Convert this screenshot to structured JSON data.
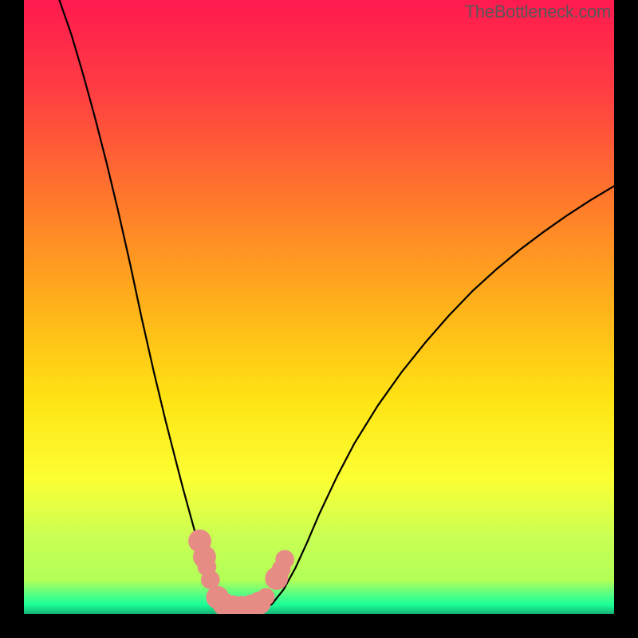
{
  "watermark": "TheBottleneck.com",
  "chart_data": {
    "type": "line",
    "title": "",
    "xlabel": "",
    "ylabel": "",
    "xlim": [
      0,
      100
    ],
    "ylim": [
      0,
      100
    ],
    "grid": false,
    "gradient_stops": [
      {
        "offset": 0.0,
        "color": "#ff1a4f"
      },
      {
        "offset": 0.15,
        "color": "#ff3e42"
      },
      {
        "offset": 0.33,
        "color": "#ff7a2b"
      },
      {
        "offset": 0.5,
        "color": "#ffb21a"
      },
      {
        "offset": 0.65,
        "color": "#ffe314"
      },
      {
        "offset": 0.78,
        "color": "#fbff33"
      },
      {
        "offset": 0.875,
        "color": "#c9ff54"
      },
      {
        "offset": 0.945,
        "color": "#b1ff56"
      },
      {
        "offset": 0.965,
        "color": "#61ff80"
      },
      {
        "offset": 0.985,
        "color": "#1aff97"
      },
      {
        "offset": 1.0,
        "color": "#16b074"
      }
    ],
    "series": [
      {
        "name": "left-curve",
        "x": [
          6,
          8,
          10,
          12,
          14,
          16,
          18,
          20,
          22,
          24,
          26,
          27,
          28,
          29,
          30,
          31,
          32,
          33,
          34
        ],
        "y": [
          100,
          94.5,
          88,
          81,
          73.5,
          65.5,
          57,
          48,
          39.5,
          31.5,
          24,
          20.3,
          16.8,
          13.3,
          10,
          6.8,
          3.9,
          1.8,
          0.4
        ]
      },
      {
        "name": "right-curve",
        "x": [
          40,
          42,
          44,
          46,
          48,
          50,
          53,
          56,
          60,
          64,
          68,
          72,
          76,
          80,
          84,
          88,
          92,
          96,
          100
        ],
        "y": [
          0.4,
          1.6,
          4.0,
          7.5,
          11.7,
          16.2,
          22.3,
          27.8,
          34.0,
          39.4,
          44.2,
          48.6,
          52.6,
          56.1,
          59.3,
          62.2,
          64.9,
          67.4,
          69.7
        ]
      },
      {
        "name": "valley-floor",
        "x": [
          34,
          35,
          36,
          37,
          38,
          39,
          40
        ],
        "y": [
          0.4,
          0.15,
          0.1,
          0.1,
          0.1,
          0.15,
          0.4
        ]
      }
    ],
    "valley_markers": {
      "color": "#e78b85",
      "points": [
        {
          "x": 29.8,
          "y": 11.9,
          "r": 1.95
        },
        {
          "x": 30.6,
          "y": 9.3,
          "r": 1.95
        },
        {
          "x": 31.0,
          "y": 7.7,
          "r": 1.6
        },
        {
          "x": 31.6,
          "y": 5.6,
          "r": 1.6
        },
        {
          "x": 32.8,
          "y": 2.7,
          "r": 1.95
        },
        {
          "x": 33.9,
          "y": 1.6,
          "r": 1.95
        },
        {
          "x": 35.3,
          "y": 1.2,
          "r": 1.95
        },
        {
          "x": 36.9,
          "y": 1.1,
          "r": 1.95
        },
        {
          "x": 38.5,
          "y": 1.3,
          "r": 1.95
        },
        {
          "x": 39.9,
          "y": 1.8,
          "r": 1.95
        },
        {
          "x": 41.0,
          "y": 2.8,
          "r": 1.5
        },
        {
          "x": 42.8,
          "y": 5.8,
          "r": 1.95
        },
        {
          "x": 43.6,
          "y": 7.3,
          "r": 1.6
        },
        {
          "x": 44.2,
          "y": 8.9,
          "r": 1.6
        }
      ]
    }
  }
}
